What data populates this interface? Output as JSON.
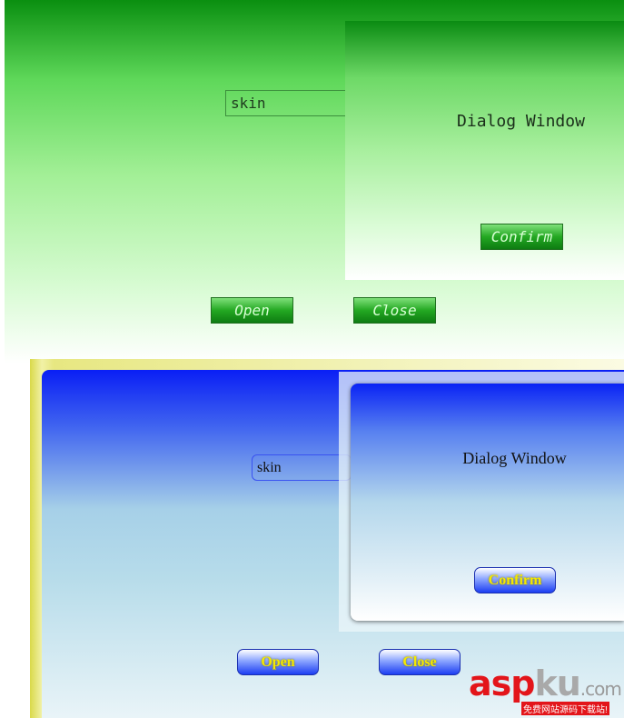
{
  "green_skin": {
    "input_value": "skin",
    "dialog": {
      "title": "Dialog Window",
      "confirm_label": "Confirm"
    },
    "open_label": "Open",
    "close_label": "Close"
  },
  "blue_skin": {
    "input_value": "skin",
    "dialog": {
      "title": "Dialog Window",
      "confirm_label": "Confirm"
    },
    "open_label": "Open",
    "close_label": "Close"
  },
  "watermark": {
    "part1": "asp",
    "part2": "ku",
    "suffix": ".com",
    "tagline": "免费网站源码下载站!"
  },
  "colors": {
    "green_accent": "#23a822",
    "blue_accent": "#1b3df2",
    "blue_button_text": "#f5e800",
    "watermark_red": "#e3151a"
  }
}
